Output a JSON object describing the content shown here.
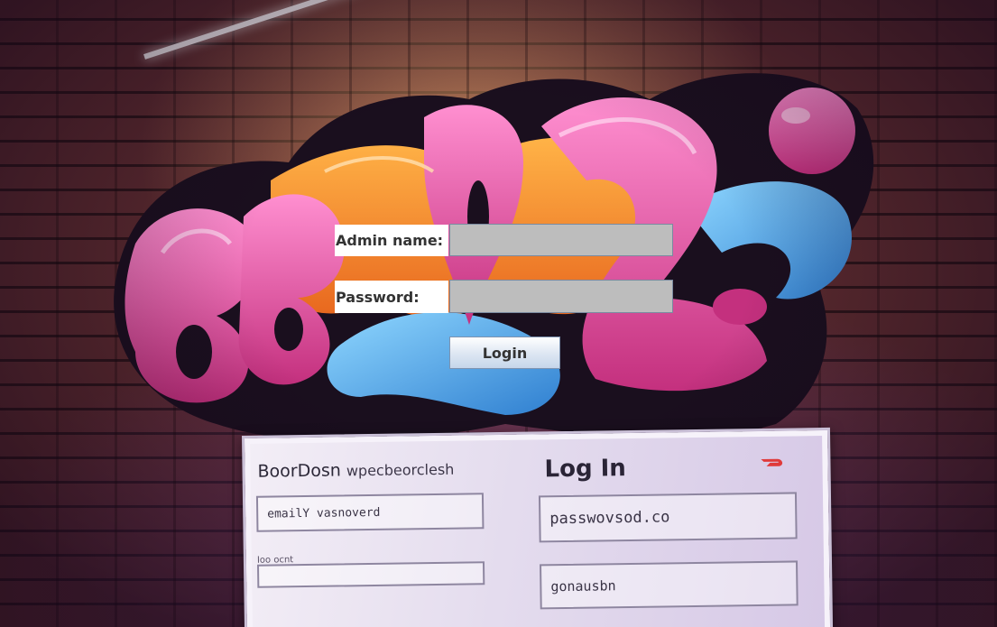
{
  "form": {
    "admin_label": "Admin name:",
    "admin_value": "",
    "password_label": "Password:",
    "password_value": "",
    "login_label": "Login"
  },
  "background_sign": {
    "brand": "BoorDosn",
    "brand_sub": "wpecbeorclesh",
    "title": "Log In",
    "left_field_text": "emailY vasnoverd",
    "left_small_text": "Ioo ocnt",
    "right_field_1_text": "passwovsod.co",
    "right_field_2_text": "gonausbn"
  },
  "colors": {
    "input_fill": "#bdbdbd",
    "label_bg": "#ffffff",
    "button_gradient_end": "#c6d6ea",
    "wall": "#4a2128",
    "graffiti_pink": "#e8459a",
    "graffiti_orange": "#f28a2a",
    "graffiti_blue": "#45a8ea"
  },
  "icons": {
    "sign_logo": "doordash-logo-icon"
  }
}
